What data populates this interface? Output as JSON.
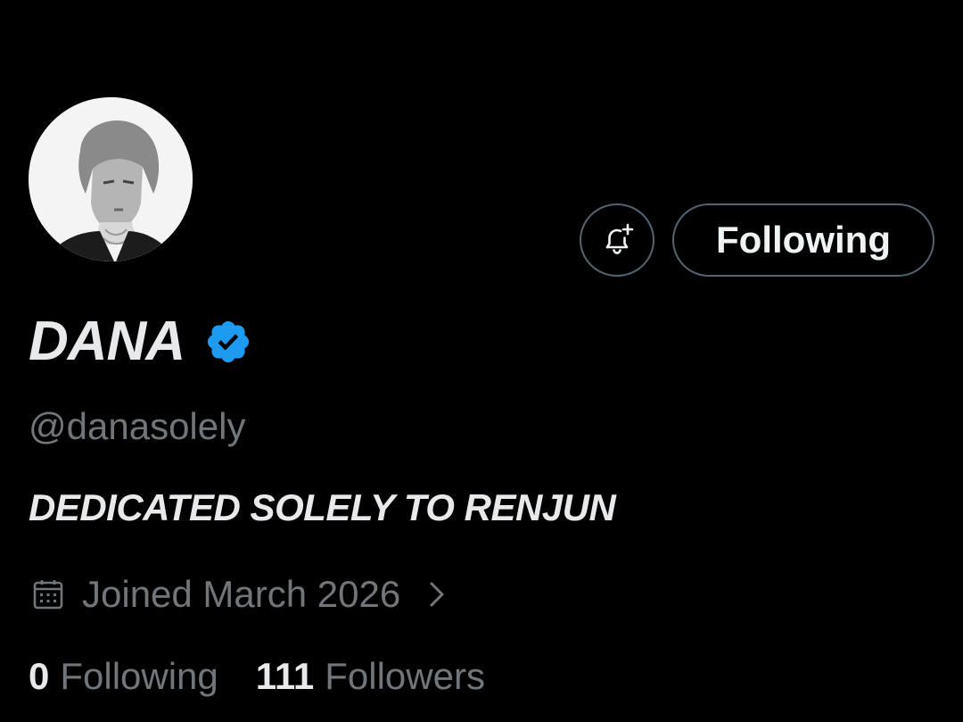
{
  "profile": {
    "display_name": "DANA",
    "handle": "@danasolely",
    "bio": "DEDICATED SOLELY TO RENJUN",
    "joined": "Joined March 2026",
    "verified": true,
    "avatar_icon": "profile-photo"
  },
  "actions": {
    "notify_icon": "bell-plus-icon",
    "follow_label": "Following"
  },
  "stats": {
    "following_count": "0",
    "following_label": "Following",
    "followers_count": "111",
    "followers_label": "Followers"
  },
  "colors": {
    "background": "#000000",
    "text_primary": "#e7e9ea",
    "text_secondary": "#71767b",
    "border": "#536471",
    "verified_blue": "#1d9bf0"
  }
}
